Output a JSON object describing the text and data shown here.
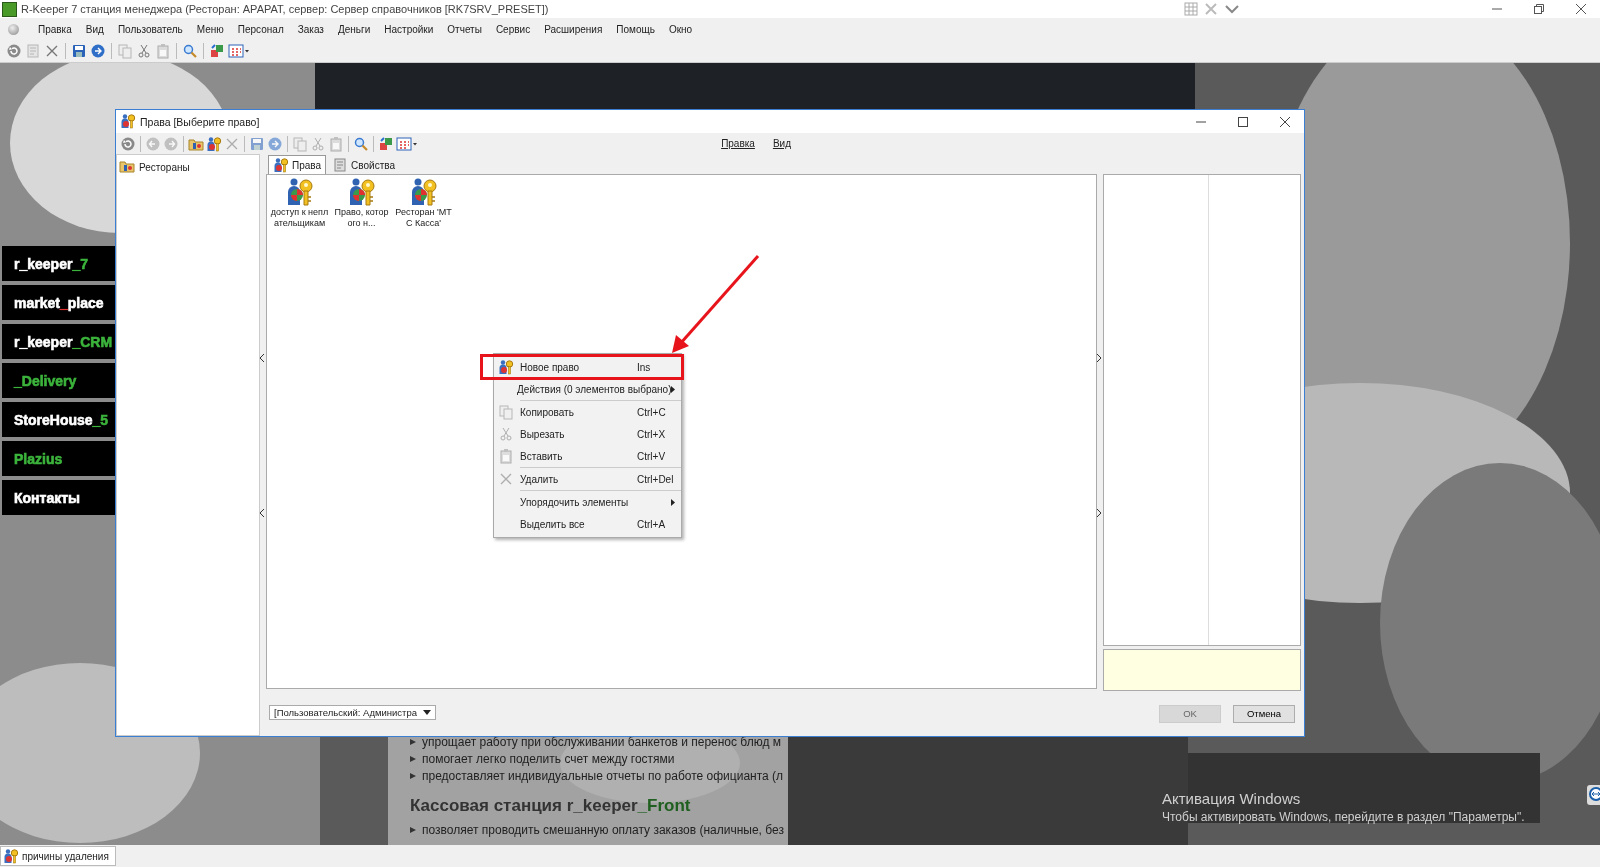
{
  "window": {
    "title": "R-Keeper 7 станция менеджера (Ресторан: APAPAT, сервер: Сервер справочников [RK7SRV_PRESET])"
  },
  "menu": [
    "Правка",
    "Вид",
    "Пользователь",
    "Меню",
    "Персонал",
    "Заказ",
    "Деньги",
    "Настройки",
    "Отчеты",
    "Сервис",
    "Расширения",
    "Помощь",
    "Окно"
  ],
  "site_menu": [
    {
      "parts": [
        {
          "text": "r_keeper",
          "color": "#ffffff"
        },
        {
          "text": "_7",
          "color": "#3cb43c"
        }
      ]
    },
    {
      "parts": [
        {
          "text": "market",
          "color": "#ffffff"
        },
        {
          "text": "_",
          "color": "#e03030"
        },
        {
          "text": "place",
          "color": "#ffffff"
        }
      ]
    },
    {
      "parts": [
        {
          "text": "r_keeper",
          "color": "#ffffff"
        },
        {
          "text": "_CRM",
          "color": "#3cb43c"
        }
      ]
    },
    {
      "parts": [
        {
          "text": "_Delivery",
          "color": "#3cb43c"
        }
      ]
    },
    {
      "parts": [
        {
          "text": "StoreHouse",
          "color": "#ffffff"
        },
        {
          "text": "_5",
          "color": "#3cb43c"
        }
      ]
    },
    {
      "parts": [
        {
          "text": "Plazius",
          "color": "#3cb43c"
        }
      ]
    },
    {
      "parts": [
        {
          "text": "Контакты",
          "color": "#ffffff"
        }
      ]
    }
  ],
  "site_text": {
    "bullets_top": [
      "упрощает работу при обслуживании банкетов и перенос блюд м",
      "помогает легко поделить счет между гостями",
      "предоставляет индивидуальные отчеты по работе официанта (л"
    ],
    "heading": [
      {
        "text": "Кассовая станция r_keeper",
        "color": "#333333"
      },
      {
        "text": "_Front",
        "color": "#1f5f1f"
      }
    ],
    "bullets_bottom": [
      "позволяет проводить смешанную оплату заказов (наличные, без"
    ]
  },
  "activation": {
    "title": "Активация Windows",
    "text": "Чтобы активировать Windows, перейдите в раздел \"Параметры\"."
  },
  "dialog": {
    "title": "Права [Выберите право]",
    "menu": [
      "Правка",
      "Вид"
    ],
    "tree": [
      {
        "label": "Рестораны",
        "selected": false
      }
    ],
    "tabs": [
      {
        "label": "Права",
        "selected": true
      },
      {
        "label": "Свойства",
        "selected": false
      }
    ],
    "items": [
      {
        "label": "доступ к неплательщикам"
      },
      {
        "label": "Право, которого н..."
      },
      {
        "label": "Ресторан 'МТС Касса'"
      }
    ],
    "context_menu": [
      {
        "kind": "item",
        "label": "Новое право",
        "shortcut": "Ins",
        "icon": true,
        "submenu": false,
        "highlighted": true
      },
      {
        "kind": "item",
        "label": "Действия (0 элементов выбрано)",
        "icon": false,
        "submenu": true,
        "highlighted": false
      },
      {
        "kind": "separator"
      },
      {
        "kind": "item",
        "label": "Копировать",
        "shortcut": "Ctrl+C",
        "icon": true,
        "submenu": false,
        "highlighted": false
      },
      {
        "kind": "item",
        "label": "Вырезать",
        "shortcut": "Ctrl+X",
        "icon": true,
        "submenu": false,
        "highlighted": false
      },
      {
        "kind": "item",
        "label": "Вставить",
        "shortcut": "Ctrl+V",
        "icon": true,
        "submenu": false,
        "highlighted": false
      },
      {
        "kind": "separator"
      },
      {
        "kind": "item",
        "label": "Удалить",
        "shortcut": "Ctrl+Del",
        "icon": true,
        "submenu": false,
        "highlighted": false
      },
      {
        "kind": "separator"
      },
      {
        "kind": "item",
        "label": "Упорядочить элементы",
        "icon": false,
        "submenu": true,
        "highlighted": false
      },
      {
        "kind": "item",
        "label": "Выделить все",
        "shortcut": "Ctrl+A",
        "icon": false,
        "submenu": false,
        "highlighted": false
      }
    ],
    "combo": {
      "value": "[Пользовательский: Администра"
    },
    "buttons": [
      {
        "label": "OK",
        "disabled": true
      },
      {
        "label": "Отмена",
        "disabled": false
      }
    ]
  },
  "status_bar": {
    "text": "причины удаления"
  }
}
